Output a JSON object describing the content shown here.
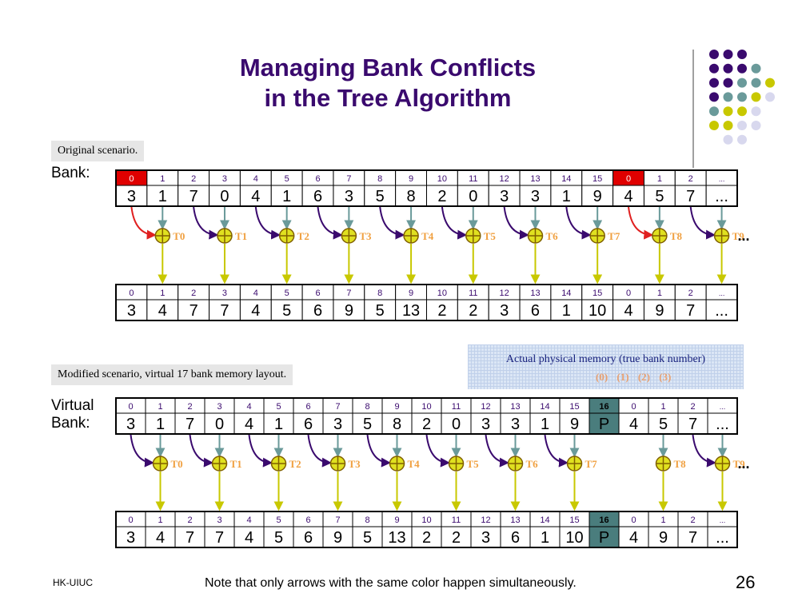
{
  "title_line1": "Managing Bank Conflicts",
  "title_line2": "in the Tree Algorithm",
  "original_label": "Original scenario.",
  "bank_label": "Bank:",
  "modified_label": "Modified scenario, virtual 17 bank memory layout.",
  "virtual_label_line1": "Virtual",
  "virtual_label_line2": "Bank:",
  "physical_title": "Actual physical memory (true bank number)",
  "physical_numbers": "(0) (1) (2) (3)",
  "footer_left": "HK-UIUC",
  "footer_note": "Note that only arrows with the same color happen simultaneously.",
  "page_number": "26",
  "colors": {
    "title": "#3a0a6e",
    "bank_text": "#3a0a6e",
    "conflict_bank": "#e00000",
    "virtual_highlight": "#4a7d7d",
    "arrow_purple": "#3a0a6e",
    "arrow_red": "#e02020",
    "arrow_teal": "#6a9a9a",
    "arrow_yellow": "#c8c800",
    "plus_circle": "#e0e020",
    "thread_label": "#f0a040",
    "dot_purple": "#3a0a6e",
    "dot_teal": "#6a9a9a",
    "dot_yellow": "#c8c800",
    "dot_lavender": "#d8d8ee"
  },
  "diagram1": {
    "banks_top": [
      "0",
      "1",
      "2",
      "3",
      "4",
      "5",
      "6",
      "7",
      "8",
      "9",
      "10",
      "11",
      "12",
      "13",
      "14",
      "15",
      "0",
      "1",
      "2",
      "..."
    ],
    "values_top": [
      "3",
      "1",
      "7",
      "0",
      "4",
      "1",
      "6",
      "3",
      "5",
      "8",
      "2",
      "0",
      "3",
      "3",
      "1",
      "9",
      "4",
      "5",
      "7",
      "..."
    ],
    "conflict_banks": [
      0,
      16
    ],
    "threads": [
      "T0",
      "T1",
      "T2",
      "T3",
      "T4",
      "T5",
      "T6",
      "T7",
      "T8",
      "T9"
    ],
    "thread_ellipsis": "...",
    "red_arrow_threads": [
      0,
      8
    ],
    "banks_bottom": [
      "0",
      "1",
      "2",
      "3",
      "4",
      "5",
      "6",
      "7",
      "8",
      "9",
      "10",
      "11",
      "12",
      "13",
      "14",
      "15",
      "0",
      "1",
      "2",
      "..."
    ],
    "values_bottom": [
      "3",
      "4",
      "7",
      "7",
      "4",
      "5",
      "6",
      "9",
      "5",
      "13",
      "2",
      "2",
      "3",
      "6",
      "1",
      "10",
      "4",
      "9",
      "7",
      "..."
    ]
  },
  "diagram2": {
    "banks_top": [
      "0",
      "1",
      "2",
      "3",
      "4",
      "5",
      "6",
      "7",
      "8",
      "9",
      "10",
      "11",
      "12",
      "13",
      "14",
      "15",
      "16",
      "0",
      "1",
      "2",
      "..."
    ],
    "values_top": [
      "3",
      "1",
      "7",
      "0",
      "4",
      "1",
      "6",
      "3",
      "5",
      "8",
      "2",
      "0",
      "3",
      "3",
      "1",
      "9",
      "P",
      "4",
      "5",
      "7",
      "..."
    ],
    "highlight_index": 16,
    "threads": [
      "T0",
      "T1",
      "T2",
      "T3",
      "T4",
      "T5",
      "T6",
      "T7",
      "T8",
      "T9"
    ],
    "thread_ellipsis": "...",
    "banks_bottom": [
      "0",
      "1",
      "2",
      "3",
      "4",
      "5",
      "6",
      "7",
      "8",
      "9",
      "10",
      "11",
      "12",
      "13",
      "14",
      "15",
      "16",
      "0",
      "1",
      "2",
      "..."
    ],
    "values_bottom": [
      "3",
      "4",
      "7",
      "7",
      "4",
      "5",
      "6",
      "9",
      "5",
      "13",
      "2",
      "2",
      "3",
      "6",
      "1",
      "10",
      "P",
      "4",
      "9",
      "7",
      "..."
    ]
  }
}
